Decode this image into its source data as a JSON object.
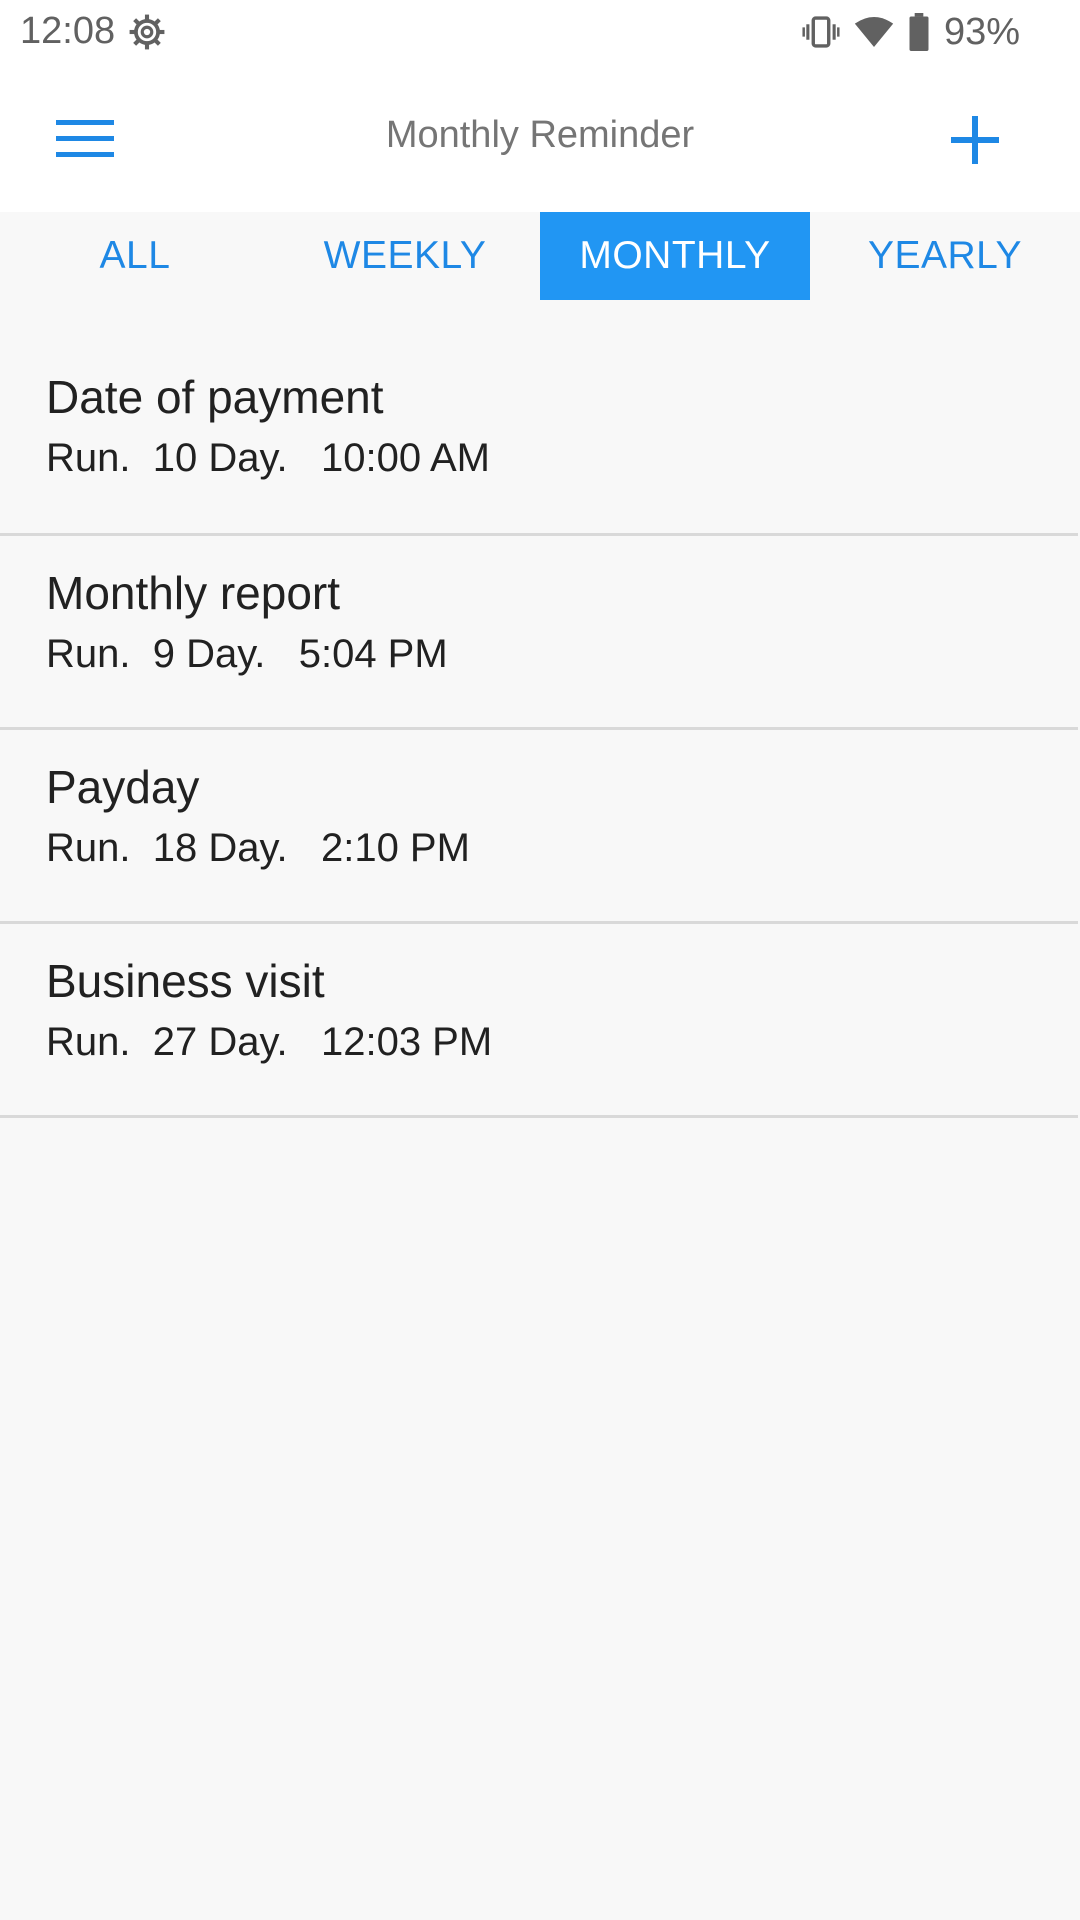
{
  "status_bar": {
    "time": "12:08",
    "battery": "93%",
    "icons": [
      "settings-gear-icon",
      "vibrate-icon",
      "wifi-icon",
      "battery-icon"
    ]
  },
  "app_bar": {
    "title": "Monthly Reminder",
    "menu_icon": "hamburger-menu-icon",
    "add_icon": "plus-icon",
    "accent_color": "#1e88e5"
  },
  "tabs": [
    {
      "label": "ALL",
      "active": false
    },
    {
      "label": "WEEKLY",
      "active": false
    },
    {
      "label": "MONTHLY",
      "active": true
    },
    {
      "label": "YEARLY",
      "active": false
    }
  ],
  "reminders": [
    {
      "title": "Date of payment",
      "run": "Run.",
      "day": "10 Day.",
      "time": "10:00 AM"
    },
    {
      "title": "Monthly report",
      "run": "Run.",
      "day": "9 Day.",
      "time": "5:04 PM"
    },
    {
      "title": "Payday",
      "run": "Run.",
      "day": "18 Day.",
      "time": "2:10 PM"
    },
    {
      "title": "Business visit",
      "run": "Run.",
      "day": "27 Day.",
      "time": "12:03 PM"
    }
  ]
}
